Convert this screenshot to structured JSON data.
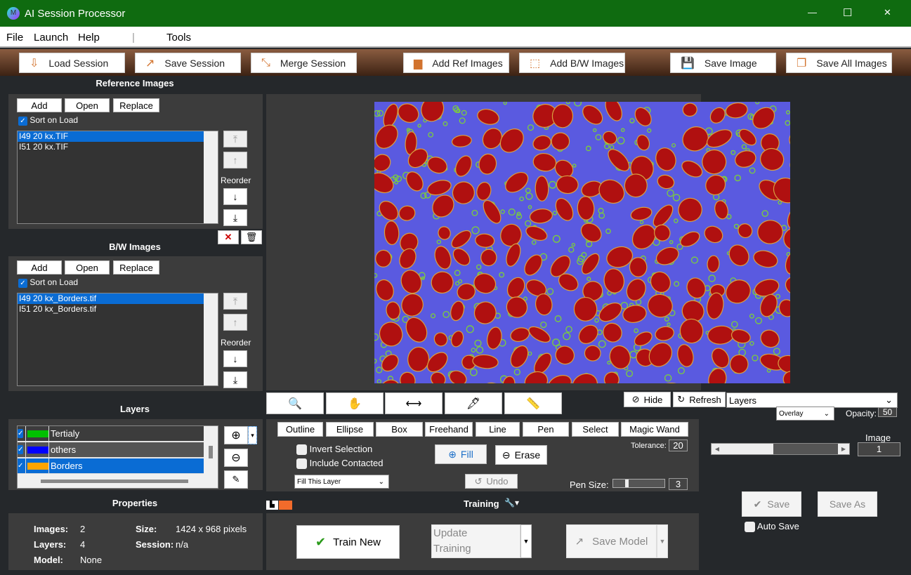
{
  "window": {
    "title": "AI Session Processor",
    "minimize": "—",
    "maximize": "☐",
    "close": "✕"
  },
  "menu": [
    "File",
    "Launch",
    "Help",
    "|",
    "Tools"
  ],
  "toolbar": [
    {
      "label": "Load Session",
      "icon": "download-icon",
      "glyph": "⇩"
    },
    {
      "label": "Save Session",
      "icon": "export-icon",
      "glyph": "↗"
    },
    {
      "label": "Merge Session",
      "icon": "merge-icon",
      "glyph": "⤡"
    },
    {
      "label": "Add Ref Images",
      "icon": "folder-icon",
      "glyph": "▆"
    },
    {
      "label": "Add B/W Images",
      "icon": "dashed-box-icon",
      "glyph": "⬚"
    },
    {
      "label": "Save Image",
      "icon": "floppy-icon",
      "glyph": "💾"
    },
    {
      "label": "Save All Images",
      "icon": "save-all-icon",
      "glyph": "❐"
    }
  ],
  "ref": {
    "title": "Reference Images",
    "add": "Add",
    "open": "Open",
    "replace": "Replace",
    "sort": "Sort on Load",
    "files": [
      "I49 20 kx.TIF",
      "I51 20 kx.TIF"
    ],
    "selected": 0,
    "reorder": "Reorder"
  },
  "bw": {
    "title": "B/W Images",
    "add": "Add",
    "open": "Open",
    "replace": "Replace",
    "sort": "Sort on Load",
    "files": [
      "I49 20 kx_Borders.tif",
      "I51 20 kx_Borders.tif"
    ],
    "selected": 0,
    "reorder": "Reorder"
  },
  "layers": {
    "title": "Layers",
    "items": [
      {
        "name": "Tertialy",
        "color": "#00c000"
      },
      {
        "name": "others",
        "color": "#0000ff"
      },
      {
        "name": "Borders",
        "color": "#ffa500"
      }
    ],
    "selected": 2
  },
  "properties": {
    "title": "Properties",
    "images_label": "Images:",
    "images": "2",
    "layers_label": "Layers:",
    "layers": "4",
    "model_label": "Model:",
    "model": "None",
    "size_label": "Size:",
    "size": "1424 x 968 pixels",
    "session_label": "Session:",
    "session": "n/a"
  },
  "view": {
    "hide": "Hide",
    "refresh": "Refresh",
    "layer_select": "Layers",
    "blend": "Overlay",
    "opacity_label": "Opacity:",
    "opacity": "50",
    "image_label": "Image",
    "image": "1",
    "image_slider": 0.25
  },
  "draw": {
    "tools": [
      "Outline",
      "Ellipse",
      "Box",
      "Freehand",
      "Line",
      "Pen",
      "Select",
      "Magic Wand"
    ],
    "invert": "Invert Selection",
    "include": "Include Contacted",
    "fill_mode": "Fill This Layer",
    "fill": "Fill",
    "erase": "Erase",
    "undo": "Undo",
    "tolerance_label": "Tolerance:",
    "tolerance": "20",
    "pen_label": "Pen Size:",
    "pen": "3"
  },
  "training": {
    "title": "Training",
    "train_new": "Train New",
    "update": "Update Training",
    "save_model": "Save Model"
  },
  "save": {
    "save": "Save",
    "save_as": "Save As",
    "auto": "Auto Save"
  },
  "colors": {
    "title_bar": "#0f6b10",
    "selection": "#0a6cd4",
    "image_bg": "#5a5ae0",
    "blob": "#b01010"
  }
}
